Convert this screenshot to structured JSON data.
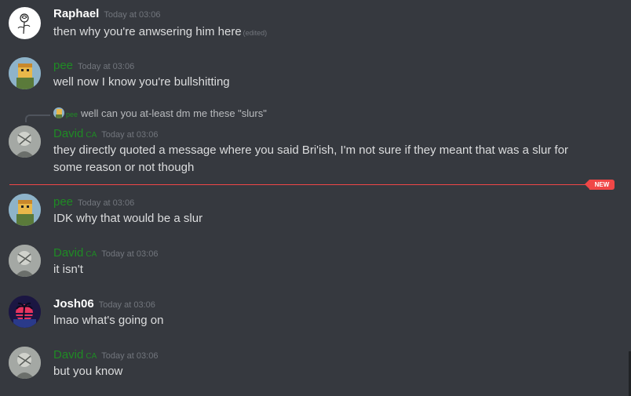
{
  "messages": [
    {
      "username": "Raphael",
      "name_color": "#ffffff",
      "timestamp": "Today at 03:06",
      "text": "then why you're anwsering him here",
      "edited": "(edited)",
      "avatar_icon": "rose-sketch-avatar"
    },
    {
      "username": "pee",
      "name_color": "#1f8b24",
      "timestamp": "Today at 03:06",
      "text": "well now I know you're bullshitting",
      "avatar_icon": "pixel-character-avatar"
    },
    {
      "username": "David",
      "tag": "CA",
      "name_color": "#1f8b24",
      "timestamp": "Today at 03:06",
      "reply": {
        "username": "pee",
        "text": "well can you at-least dm me these \"slurs\""
      },
      "text_line1": "they directly quoted a message where you said Bri'ish, I'm not sure if they meant that was a slur for",
      "text_line2": "some reason or not though",
      "avatar_icon": "grey-sketch-avatar"
    },
    {
      "username": "pee",
      "name_color": "#1f8b24",
      "timestamp": "Today at 03:06",
      "text": "IDK why that would be a slur",
      "avatar_icon": "pixel-character-avatar"
    },
    {
      "username": "David",
      "tag": "CA",
      "name_color": "#1f8b24",
      "timestamp": "Today at 03:06",
      "text": "it isn't",
      "avatar_icon": "grey-sketch-avatar"
    },
    {
      "username": "Josh06",
      "name_color": "#ffffff",
      "timestamp": "Today at 03:06",
      "text": "lmao what's going on",
      "avatar_icon": "palm-sunset-avatar"
    },
    {
      "username": "David",
      "tag": "CA",
      "name_color": "#1f8b24",
      "timestamp": "Today at 03:06",
      "text": "but you know",
      "avatar_icon": "grey-sketch-avatar"
    }
  ],
  "new_divider": {
    "label": "NEW",
    "color": "#f04747"
  },
  "theme": {
    "background": "#36393f",
    "text": "#dcddde",
    "muted": "#72767d"
  }
}
